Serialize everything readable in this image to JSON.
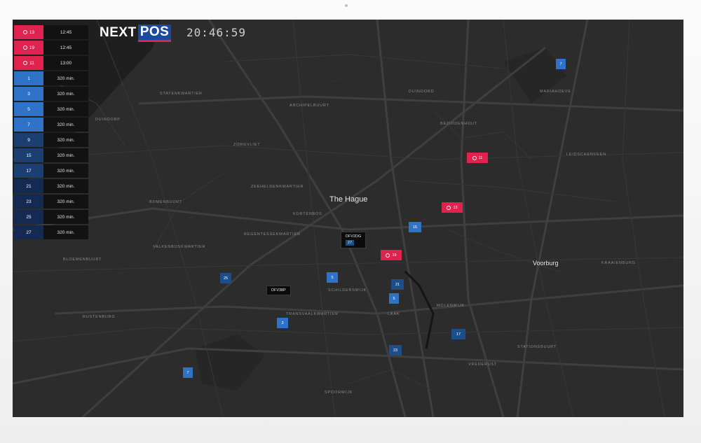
{
  "header": {
    "logo_a": "NEXT",
    "logo_b": "POS",
    "clock": "20:46:59"
  },
  "panel": [
    {
      "id": "13",
      "value": "12:45",
      "kind": "alert"
    },
    {
      "id": "19",
      "value": "12:45",
      "kind": "alert"
    },
    {
      "id": "11",
      "value": "13:00",
      "kind": "alert"
    },
    {
      "id": "1",
      "value": "320 min.",
      "kind": "blue"
    },
    {
      "id": "3",
      "value": "320 min.",
      "kind": "blue"
    },
    {
      "id": "5",
      "value": "320 min.",
      "kind": "blue"
    },
    {
      "id": "7",
      "value": "320 min.",
      "kind": "blue"
    },
    {
      "id": "9",
      "value": "320 min.",
      "kind": "navy"
    },
    {
      "id": "15",
      "value": "320 min.",
      "kind": "navy"
    },
    {
      "id": "17",
      "value": "320 min.",
      "kind": "navy"
    },
    {
      "id": "21",
      "value": "320 min.",
      "kind": "dark"
    },
    {
      "id": "23",
      "value": "320 min.",
      "kind": "dark"
    },
    {
      "id": "25",
      "value": "320 min.",
      "kind": "dark"
    },
    {
      "id": "27",
      "value": "320 min.",
      "kind": "dark"
    }
  ],
  "map": {
    "cities": {
      "hague": "The Hague",
      "voorburg": "Voorburg"
    },
    "districts": {
      "duinzorp": "DUINDORP",
      "archipel": "ARCHIPELBUURT",
      "statenkwartier": "STATENKWARTIER",
      "zorgvliet": "ZORGVLIET",
      "bomenbuurt": "BOMENBUURT",
      "zeeheldenkwartier": "ZEEHELDENKWARTIER",
      "korte": "KORTENBOS",
      "valkenbos": "VALKENBOSKWARTIER",
      "bloemenbuurt": "BLOEMENBUURT",
      "regentessekwartier": "REGENTESSEKWARTIER",
      "rustenburg": "RUSTENBURG",
      "schildersbuurt": "SCHILDERSWIJK",
      "transvaalkwartier": "TRANSVAALKWARTIER",
      "laak": "LAAK",
      "molenwijk": "MOLENWIJK",
      "bezuidenhout": "BEZUIDENHOUT",
      "mariahoeve": "MARIAHOEVE",
      "leidschenveen": "LEIDSCHENVEEN",
      "spoorwijk": "SPOORWIJK",
      "vrederust": "VREDERUST",
      "station": "STATIONSBUURT",
      "kraaienburg": "KRAAIENBURG",
      "duinoord": "DUINOORD"
    },
    "markers": [
      {
        "label": "7",
        "kind": "blue"
      },
      {
        "label": "11",
        "kind": "alert"
      },
      {
        "label": "13",
        "kind": "alert"
      },
      {
        "label": "15",
        "kind": "blue"
      },
      {
        "label": "19",
        "kind": "alert"
      },
      {
        "label": "25",
        "kind": "navy"
      },
      {
        "label": "5",
        "kind": "blue"
      },
      {
        "label": "21",
        "kind": "navy"
      },
      {
        "label": "5",
        "kind": "blue"
      },
      {
        "label": "3",
        "kind": "blue"
      },
      {
        "label": "17",
        "kind": "navy"
      },
      {
        "label": "23",
        "kind": "navy"
      },
      {
        "label": "7",
        "kind": "blue"
      }
    ],
    "tags": [
      {
        "label": "DFV2DG",
        "sub": "27"
      },
      {
        "label": "DFV38P"
      }
    ]
  }
}
